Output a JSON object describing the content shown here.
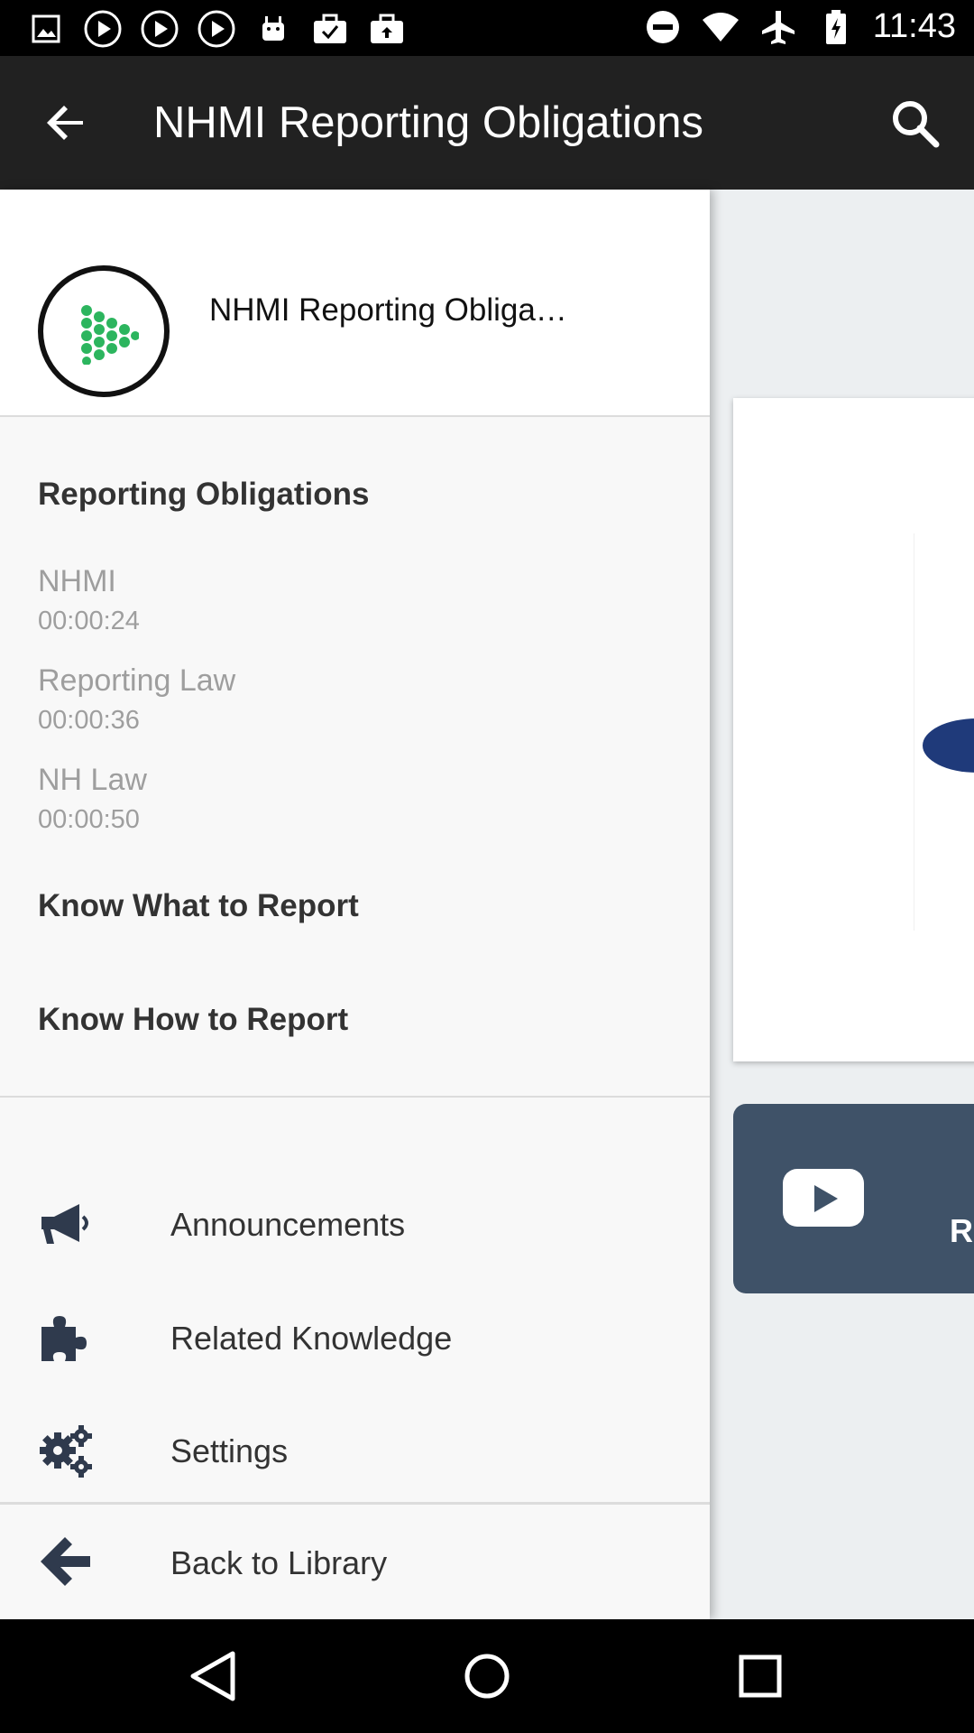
{
  "status_bar": {
    "time": "11:43",
    "left_icons": [
      "image-icon",
      "play-circle-icon",
      "play-circle-icon",
      "play-circle-icon",
      "android-icon",
      "briefcase-check-icon",
      "briefcase-upload-icon"
    ],
    "right_icons": [
      "do-not-disturb-icon",
      "wifi-icon",
      "airplane-icon",
      "battery-charging-icon"
    ]
  },
  "app_bar": {
    "title": "NHMI Reporting Obligations",
    "back_icon": "arrow-back-icon",
    "search_icon": "search-icon"
  },
  "drawer": {
    "header_title": "NHMI Reporting Obliga…",
    "section_title": "Reporting Obligations",
    "chapters": [
      {
        "name": "NHMI",
        "time": "00:00:24"
      },
      {
        "name": "Reporting Law",
        "time": "00:00:36"
      },
      {
        "name": "NH Law",
        "time": "00:00:50"
      }
    ],
    "sections": [
      "Know What to Report",
      "Know How to Report"
    ],
    "menu": [
      {
        "label": "Announcements",
        "icon": "megaphone-icon"
      },
      {
        "label": "Related Knowledge",
        "icon": "puzzle-icon"
      },
      {
        "label": "Settings",
        "icon": "gears-icon"
      }
    ],
    "footer": {
      "label": "Back to Library",
      "icon": "arrow-left-icon"
    }
  },
  "content": {
    "yt_label": "R"
  },
  "colors": {
    "app_bar": "#212121",
    "logo_green": "#2cb55e",
    "card_dark": "#3f5268",
    "drawer_bg": "#f8f8f8"
  }
}
